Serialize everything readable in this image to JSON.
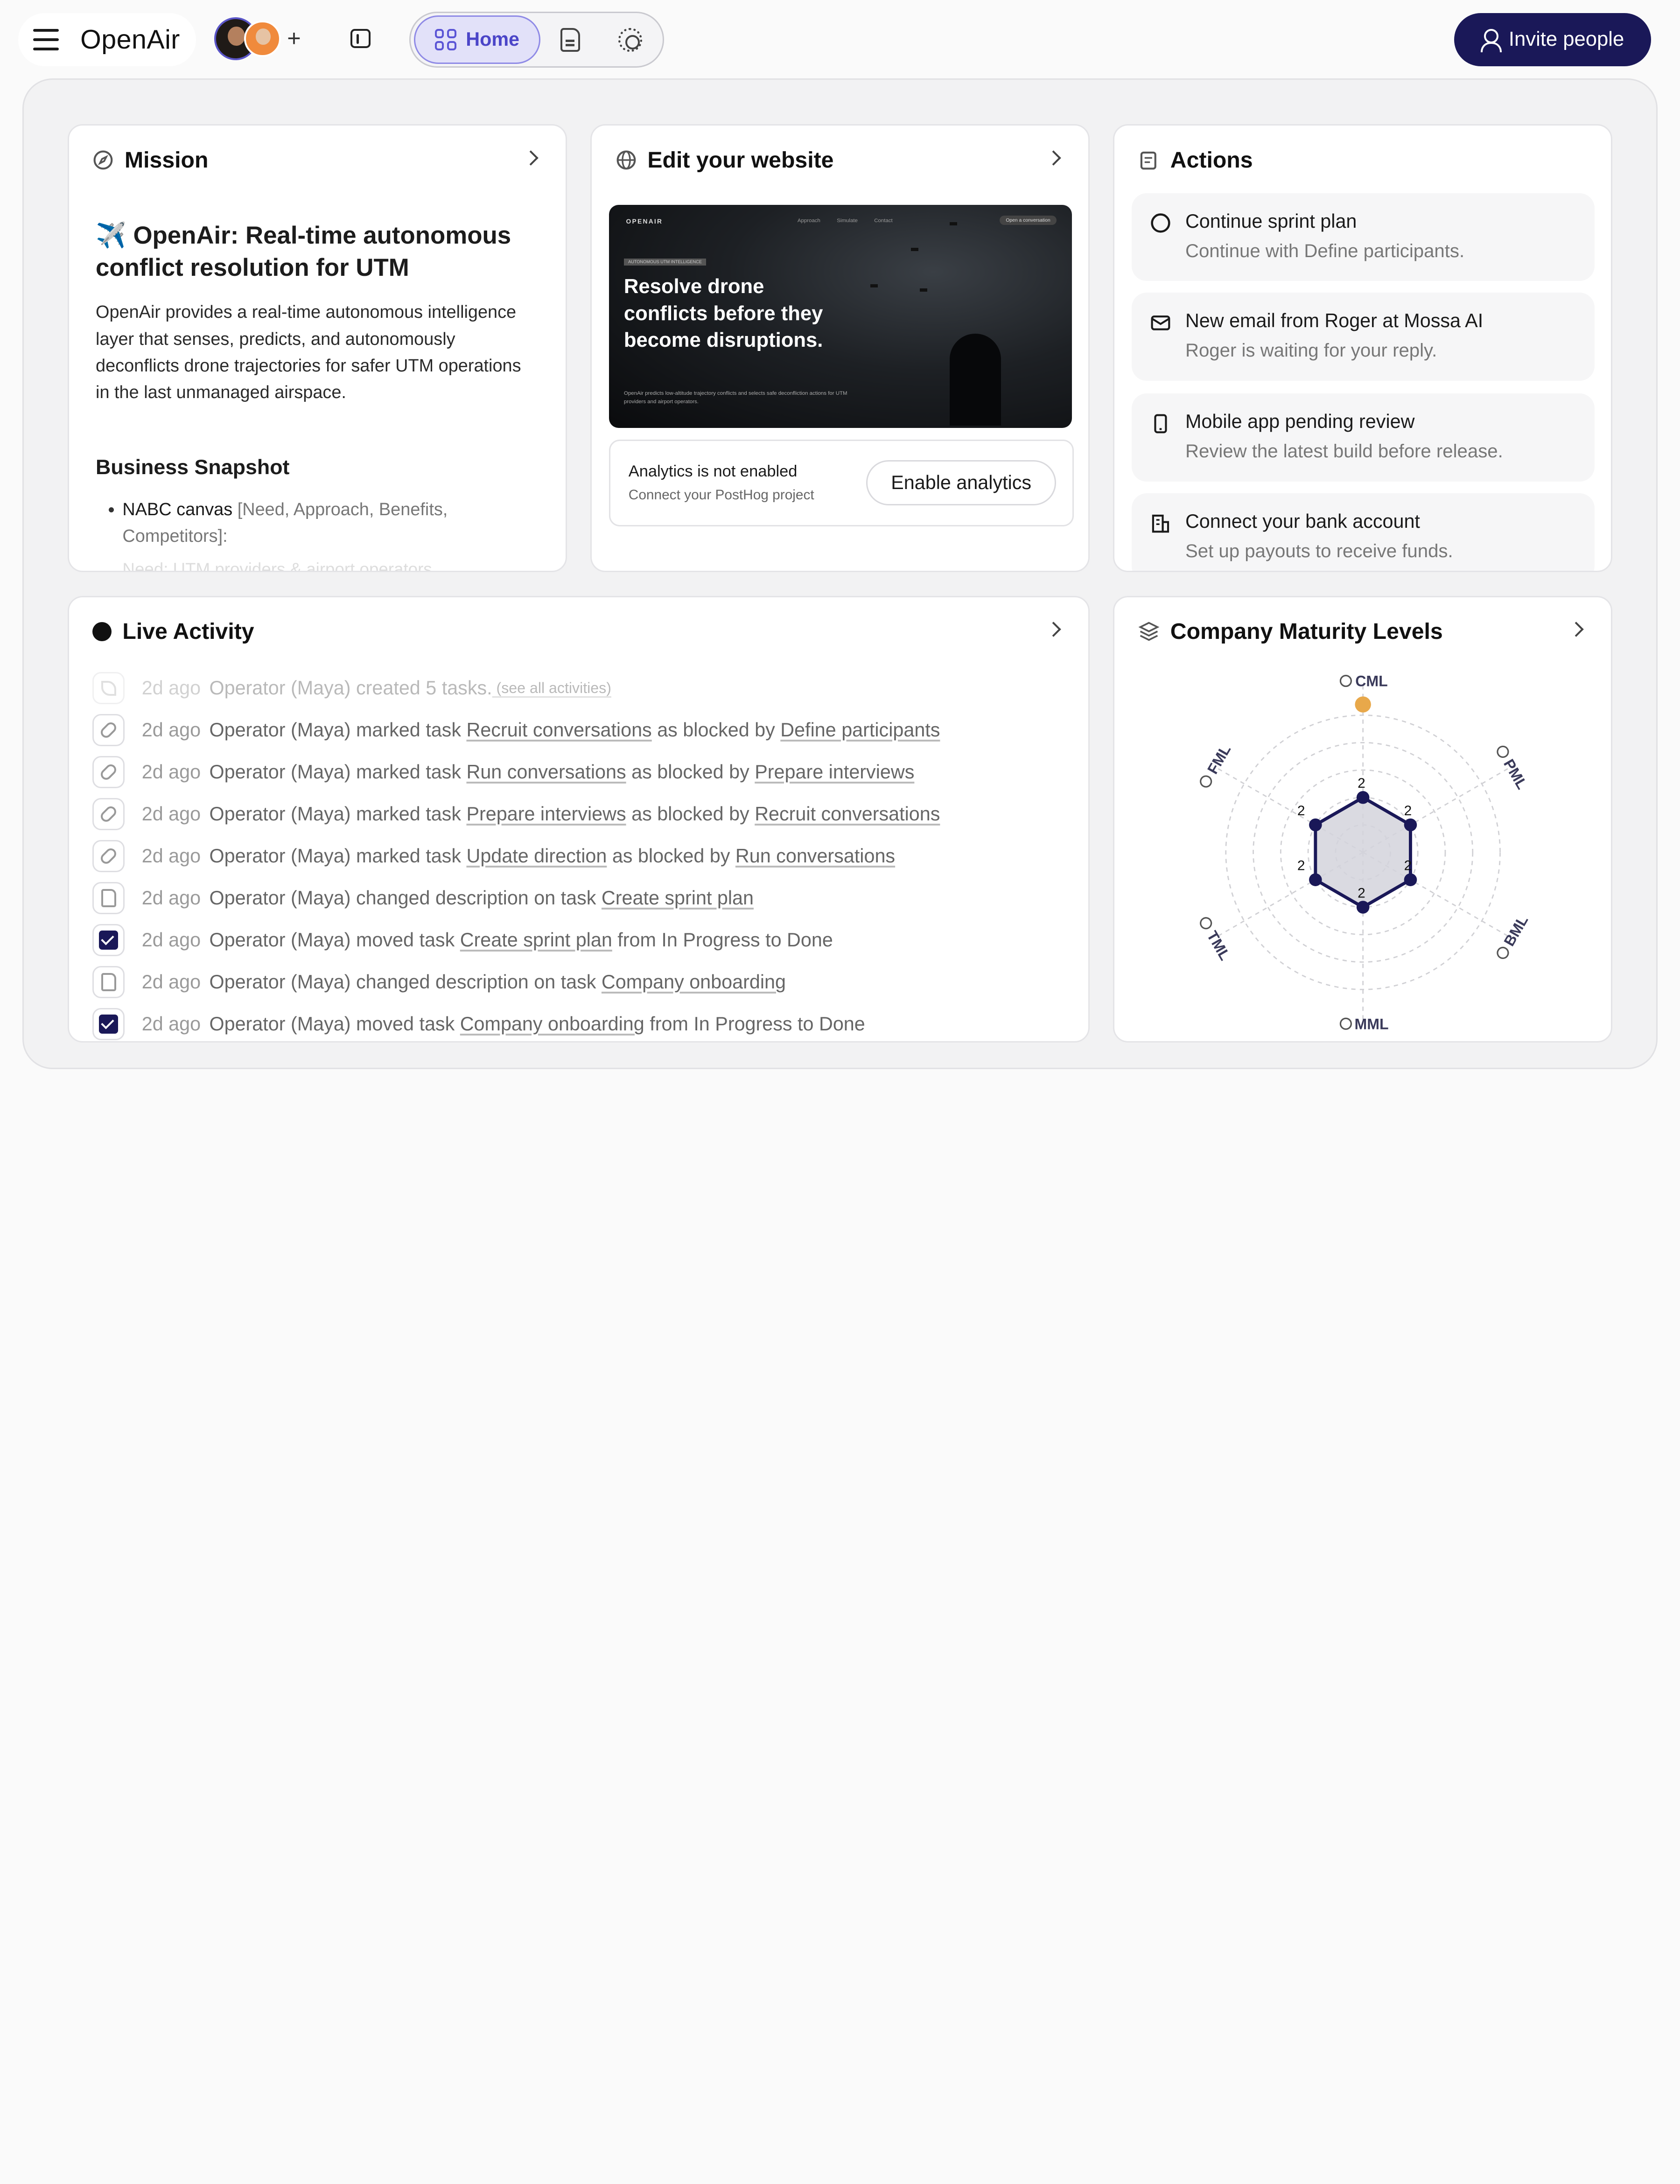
{
  "app": {
    "name": "OpenAir"
  },
  "topbar": {
    "nav": {
      "home_label": "Home"
    },
    "invite_label": "Invite people"
  },
  "mission": {
    "header": "Mission",
    "title_emoji": "✈️",
    "title": "OpenAir: Real-time autonomous conflict resolution for UTM",
    "body": "OpenAir provides a real-time autonomous intelligence layer that senses, predicts, and autonomously deconflicts drone trajectories for safer UTM operations in the last unmanaged airspace.",
    "subheading": "Business Snapshot",
    "bullet_main": "NABC canvas",
    "bullet_detail": "[Need, Approach, Benefits, Competitors]:",
    "faded_text": "Need: UTM providers & airport operators..."
  },
  "website": {
    "header": "Edit your website",
    "preview": {
      "logo": "OPENAIR",
      "nav": "Approach  Simulate  Contact",
      "cta": "Open a conversation",
      "tag": "AUTONOMOUS UTM INTELLIGENCE",
      "headline": "Resolve drone conflicts before they become disruptions.",
      "subtext": "OpenAir predicts low-altitude trajectory conflicts and selects safe deconfliction actions for UTM providers and airport operators."
    },
    "analytics_title": "Analytics is not enabled",
    "analytics_sub": "Connect your PostHog project",
    "analytics_button": "Enable analytics"
  },
  "actions": {
    "header": "Actions",
    "items": [
      {
        "icon": "circle-icon",
        "title": "Continue sprint plan",
        "sub": "Continue with Define participants."
      },
      {
        "icon": "mail-icon",
        "title": "New email from Roger at Mossa AI",
        "sub": "Roger is waiting for your reply."
      },
      {
        "icon": "phone-icon",
        "title": "Mobile app pending review",
        "sub": "Review the latest build before release."
      },
      {
        "icon": "bank-icon",
        "title": "Connect your bank account",
        "sub": "Set up payouts to receive funds."
      }
    ]
  },
  "live": {
    "header": "Live Activity",
    "rows": [
      {
        "icon": "seedling-icon",
        "time": "2d ago",
        "pre": "Operator (Maya) created 5 tasks.",
        "link1": "",
        "mid": "",
        "link2": "",
        "post": "",
        "more": "(see all activities)",
        "faded": true
      },
      {
        "icon": "link-icon",
        "time": "2d ago",
        "pre": "Operator (Maya) marked task ",
        "link1": "Recruit conversations",
        "mid": " as blocked by ",
        "link2": "Define participants",
        "post": "",
        "more": ""
      },
      {
        "icon": "link-icon",
        "time": "2d ago",
        "pre": "Operator (Maya) marked task ",
        "link1": "Run conversations",
        "mid": " as blocked by ",
        "link2": "Prepare interviews",
        "post": "",
        "more": ""
      },
      {
        "icon": "link-icon",
        "time": "2d ago",
        "pre": "Operator (Maya) marked task ",
        "link1": "Prepare interviews",
        "mid": " as blocked by ",
        "link2": "Recruit conversations",
        "post": "",
        "more": ""
      },
      {
        "icon": "link-icon",
        "time": "2d ago",
        "pre": "Operator (Maya) marked task ",
        "link1": "Update direction",
        "mid": " as blocked by ",
        "link2": "Run conversations",
        "post": "",
        "more": ""
      },
      {
        "icon": "document-icon",
        "time": "2d ago",
        "pre": "Operator (Maya) changed description on task ",
        "link1": "Create sprint plan",
        "mid": "",
        "link2": "",
        "post": "",
        "more": ""
      },
      {
        "icon": "checkbox-icon",
        "time": "2d ago",
        "pre": "Operator (Maya) moved task ",
        "link1": "Create sprint plan",
        "mid": "",
        "link2": "",
        "post": " from In Progress to Done",
        "more": ""
      },
      {
        "icon": "document-icon",
        "time": "2d ago",
        "pre": "Operator (Maya) changed description on task ",
        "link1": "Company onboarding",
        "mid": "",
        "link2": "",
        "post": "",
        "more": ""
      },
      {
        "icon": "checkbox-icon",
        "time": "2d ago",
        "pre": "Operator (Maya) moved task ",
        "link1": "Company onboarding",
        "mid": "",
        "link2": "",
        "post": " from In Progress to Done",
        "more": ""
      }
    ]
  },
  "maturity": {
    "header": "Company Maturity Levels"
  },
  "chart_data": {
    "type": "radar",
    "categories": [
      "CML",
      "PML",
      "BML",
      "MML",
      "TML",
      "FML"
    ],
    "values": [
      2,
      2,
      2,
      2,
      2,
      2
    ],
    "value_labels": [
      "2",
      "2",
      "2",
      "2",
      "2",
      "2"
    ],
    "max": 5,
    "rings": 5,
    "colors": {
      "fill": "#d4d4dc",
      "stroke": "#1a1858",
      "point": "#1a1858",
      "target": "#e8a84a",
      "grid": "#d0d0d4"
    },
    "target_point": {
      "category": "CML",
      "value": 5
    }
  }
}
